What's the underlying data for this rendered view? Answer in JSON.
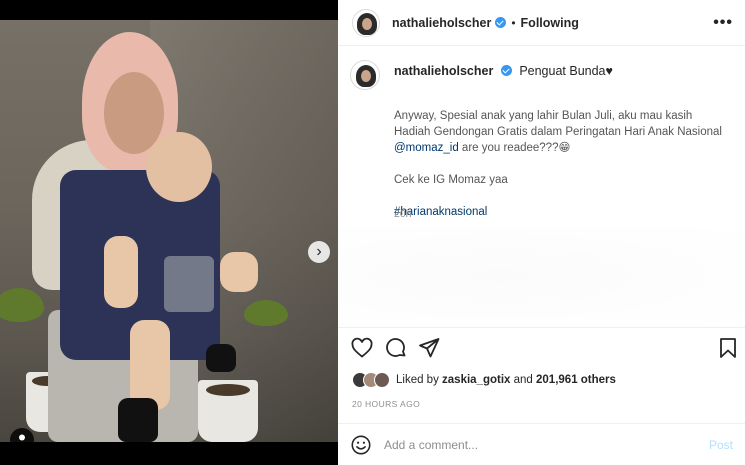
{
  "header": {
    "username": "nathalieholscher",
    "separator": "•",
    "follow_status": "Following",
    "more_glyph": "•••"
  },
  "caption": {
    "username": "nathalieholscher",
    "bio": "Penguat Bunda♥",
    "line1": "Anyway, Spesial anak yang lahir Bulan Juli, aku mau kasih Hadiah Gendongan Gratis dalam Peringatan Hari Anak Nasional",
    "mention": "@momaz_id",
    "line1_tail": " are you readee???😁",
    "line2": "Cek ke IG Momaz yaa",
    "hashtag": "#harianaknasional",
    "time": "20h"
  },
  "likes": {
    "prefix": "Liked by ",
    "user": "zaskia_gotix",
    "middle": " and ",
    "count": "201,961 others"
  },
  "posted_time": "20 HOURS AGO",
  "comment": {
    "placeholder": "Add a comment...",
    "post_label": "Post"
  },
  "media": {
    "next_glyph": "›",
    "slide_count": 2,
    "active_slide": 1
  },
  "colors": {
    "accent": "#3897f0",
    "link": "#00376b",
    "post_disabled": "#b2dffc"
  },
  "icons": [
    "heart-icon",
    "comment-icon",
    "share-icon",
    "bookmark-icon",
    "smile-icon",
    "verified-icon",
    "user-tag-icon"
  ]
}
